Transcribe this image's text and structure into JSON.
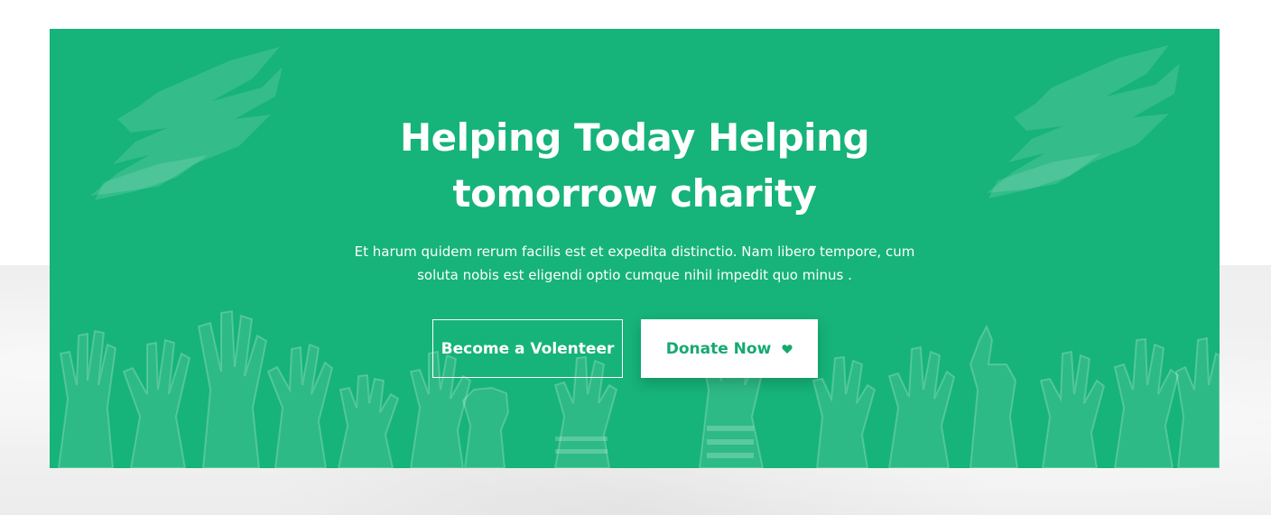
{
  "colors": {
    "banner_green": "#16b37a",
    "accent_text": "#16a971",
    "text_white": "#ffffff",
    "backdrop_grey": "#efefef"
  },
  "banner": {
    "headline_line1": "Helping Today Helping",
    "headline_line2": "tomorrow charity",
    "subtext_line1": "Et harum quidem rerum facilis est et expedita distinctio. Nam libero tempore, cum",
    "subtext_line2": "soluta nobis est eligendi optio cumque nihil impedit quo minus ."
  },
  "buttons": {
    "volunteer_label": "Become a Volenteer",
    "donate_label": "Donate Now",
    "donate_icon": "heart-icon"
  },
  "decorations": {
    "brush_strokes": "brush-stroke",
    "illustration": "raised-hands-illustration"
  }
}
